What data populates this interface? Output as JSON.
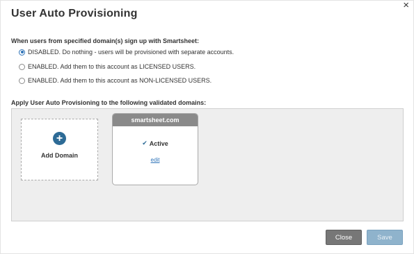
{
  "dialog": {
    "title": "User Auto Provisioning",
    "close_icon": "close-icon"
  },
  "signup_section": {
    "label": "When users from specified domain(s) sign up with Smartsheet:",
    "options": [
      {
        "label": "DISABLED. Do nothing - users will be provisioned with separate accounts.",
        "checked": true
      },
      {
        "label": "ENABLED. Add them to this account as LICENSED USERS.",
        "checked": false
      },
      {
        "label": "ENABLED. Add them to this account as NON-LICENSED USERS.",
        "checked": false
      }
    ]
  },
  "domains_section": {
    "label": "Apply User Auto Provisioning to the following validated domains:",
    "add_domain": {
      "icon": "plus-circle-icon",
      "label": "Add Domain"
    },
    "domains": [
      {
        "name": "smartsheet.com",
        "status": "Active",
        "status_icon": "checkmark-icon",
        "edit_label": "edit"
      }
    ]
  },
  "footer": {
    "close_label": "Close",
    "save_label": "Save"
  },
  "colors": {
    "accent": "#2d6b96",
    "link": "#2e73b8",
    "close_button": "#777777",
    "save_button_disabled": "#8fb3cc",
    "domain_header": "#8a8a8a",
    "area_background": "#eeeeee"
  }
}
